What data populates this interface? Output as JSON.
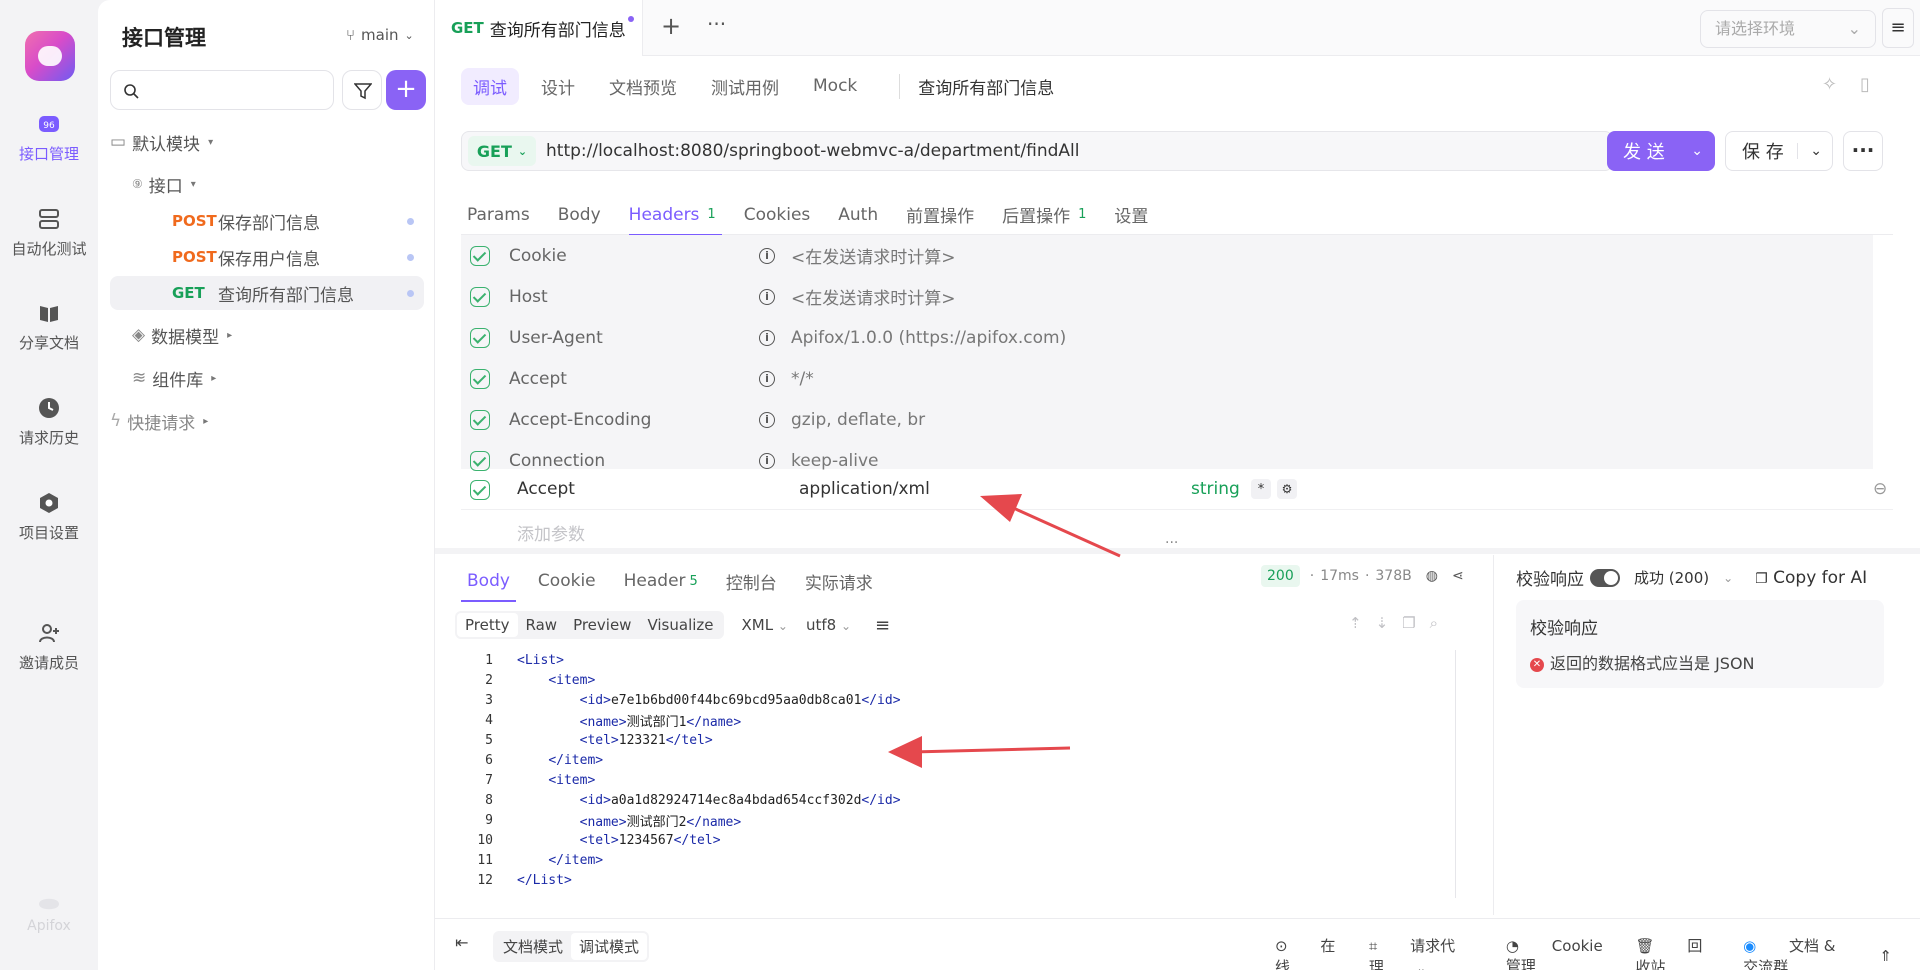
{
  "rail": {
    "items": [
      {
        "label": "接口管理",
        "icon": "api-icon"
      },
      {
        "label": "自动化测试",
        "icon": "automation-icon"
      },
      {
        "label": "分享文档",
        "icon": "book-icon"
      },
      {
        "label": "请求历史",
        "icon": "clock-icon"
      },
      {
        "label": "项目设置",
        "icon": "hexagon-icon"
      },
      {
        "label": "邀请成员",
        "icon": "user-plus-icon"
      }
    ],
    "brand": "Apifox"
  },
  "sidebar": {
    "title": "接口管理",
    "branch": "main",
    "tree": {
      "default_module": "默认模块",
      "api_folder": "接口",
      "apis": [
        {
          "method": "POST",
          "name": "保存部门信息"
        },
        {
          "method": "POST",
          "name": "保存用户信息"
        },
        {
          "method": "GET",
          "name": "查询所有部门信息"
        }
      ],
      "data_model": "数据模型",
      "components": "组件库",
      "quick_request": "快捷请求"
    }
  },
  "tabbar": {
    "active_method": "GET",
    "active_title": "查询所有部门信息",
    "env_placeholder": "请选择环境"
  },
  "subtabs": [
    "调试",
    "设计",
    "文档预览",
    "测试用例",
    "Mock"
  ],
  "request_title": "查询所有部门信息",
  "url": {
    "method": "GET",
    "value": "http://localhost:8080/springboot-webmvc-a/department/findAll",
    "send": "发 送",
    "save": "保 存"
  },
  "request_tabs": [
    {
      "label": "Params",
      "badge": ""
    },
    {
      "label": "Body",
      "badge": ""
    },
    {
      "label": "Headers",
      "badge": "1"
    },
    {
      "label": "Cookies",
      "badge": ""
    },
    {
      "label": "Auth",
      "badge": ""
    },
    {
      "label": "前置操作",
      "badge": ""
    },
    {
      "label": "后置操作",
      "badge": "1"
    },
    {
      "label": "设置",
      "badge": ""
    }
  ],
  "auto_headers": [
    {
      "name": "Cookie",
      "value": "<在发送请求时计算>"
    },
    {
      "name": "Host",
      "value": "<在发送请求时计算>"
    },
    {
      "name": "User-Agent",
      "value": "Apifox/1.0.0 (https://apifox.com)"
    },
    {
      "name": "Accept",
      "value": "*/*"
    },
    {
      "name": "Accept-Encoding",
      "value": "gzip, deflate, br"
    },
    {
      "name": "Connection",
      "value": "keep-alive"
    }
  ],
  "custom_header": {
    "name": "Accept",
    "value": "application/xml",
    "type": "string",
    "required_mark": "*"
  },
  "add_param_placeholder": "添加参数",
  "response": {
    "tabs": [
      {
        "label": "Body",
        "badge": ""
      },
      {
        "label": "Cookie",
        "badge": ""
      },
      {
        "label": "Header",
        "badge": "5"
      },
      {
        "label": "控制台",
        "badge": ""
      },
      {
        "label": "实际请求",
        "badge": ""
      }
    ],
    "status_code": "200",
    "time": "17ms",
    "size": "378B",
    "views": [
      "Pretty",
      "Raw",
      "Preview",
      "Visualize"
    ],
    "format": "XML",
    "encoding": "utf8",
    "code_lines": [
      "<List>",
      "    <item>",
      "        <id>e7e1b6bd00f44bc69bcd95aa0db8ca01</id>",
      "        <name>测试部门1</name>",
      "        <tel>123321</tel>",
      "    </item>",
      "    <item>",
      "        <id>a0a1d82924714ec8a4bdad654ccf302d</id>",
      "        <name>测试部门2</name>",
      "        <tel>1234567</tel>",
      "    </item>",
      "</List>"
    ]
  },
  "validate": {
    "label": "校验响应",
    "status": "成功 (200)",
    "copy_ai": "Copy for AI",
    "box_title": "校验响应",
    "message": "返回的数据格式应当是 JSON"
  },
  "footer": {
    "doc_mode": "文档模式",
    "debug_mode": "调试模式",
    "online": "在线",
    "proxy": "请求代理",
    "cookie_mgmt": "Cookie 管理",
    "recycle": "回收站",
    "community": "文档 & 交流群"
  },
  "colors": {
    "accent": "#8a63f5",
    "get": "#18a058",
    "post": "#f06a1d",
    "arrow": "#e5484d"
  }
}
